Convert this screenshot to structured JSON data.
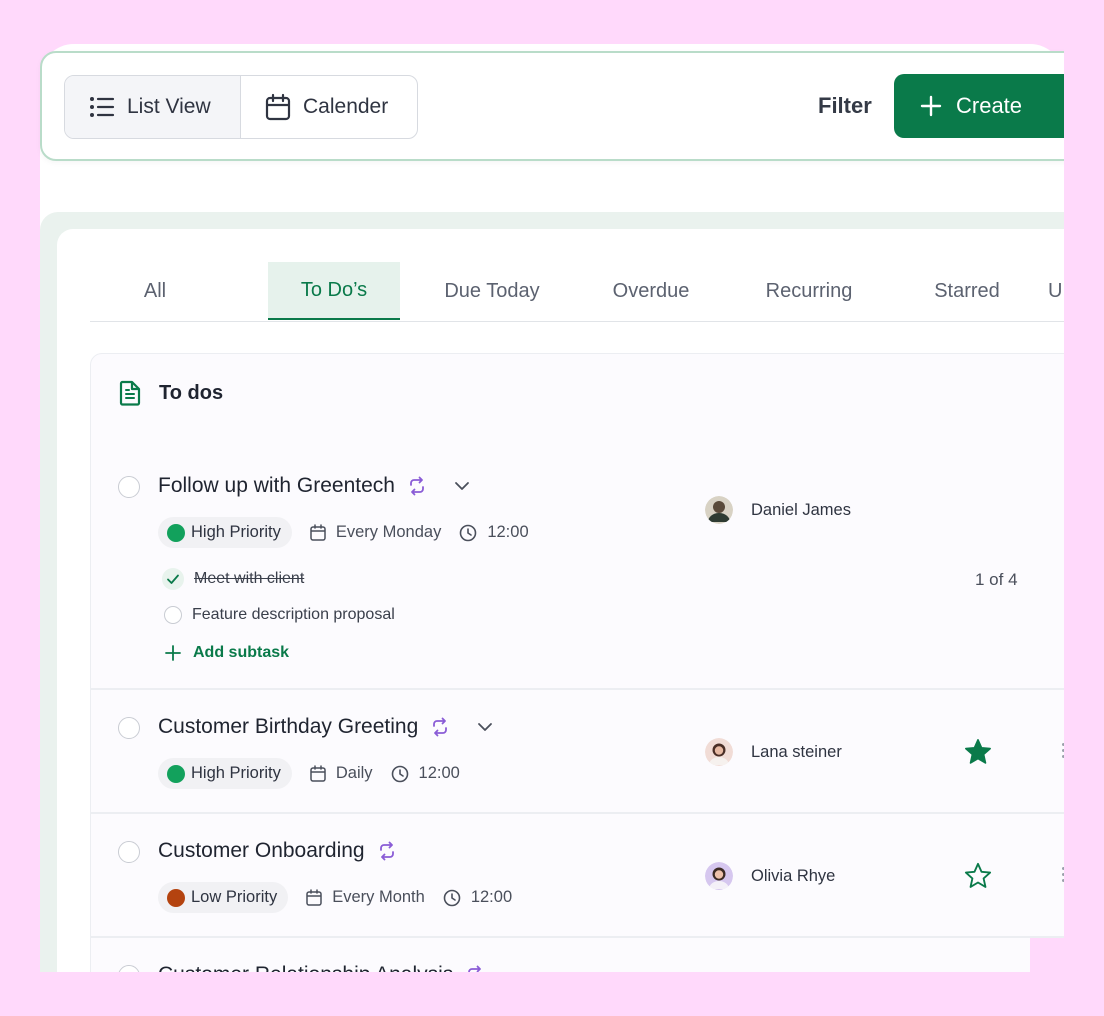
{
  "toolbar": {
    "list_view_label": "List View",
    "calendar_label": "Calender",
    "filter_label": "Filter",
    "create_label": "Create"
  },
  "tabs": [
    {
      "label": "All",
      "active": false
    },
    {
      "label": "To Do’s",
      "active": true
    },
    {
      "label": "Due Today",
      "active": false
    },
    {
      "label": "Overdue",
      "active": false
    },
    {
      "label": "Recurring",
      "active": false
    },
    {
      "label": "Starred",
      "active": false
    },
    {
      "label": "U",
      "active": false
    }
  ],
  "list": {
    "heading": "To dos",
    "tasks": [
      {
        "title": "Follow up with Greentech",
        "recurring": true,
        "expandable": true,
        "priority": "High Priority",
        "priority_color": "#12a15c",
        "schedule": "Every Monday",
        "time": "12:00",
        "assignee": "Daniel James",
        "subtasks": [
          {
            "label": "Meet with client",
            "done": true
          },
          {
            "label": "Feature description proposal",
            "done": false
          }
        ],
        "add_subtask_label": "Add subtask",
        "subtask_counter": "1 of 4"
      },
      {
        "title": "Customer Birthday Greeting",
        "recurring": true,
        "expandable": true,
        "priority": "High Priority",
        "priority_color": "#12a15c",
        "schedule": "Daily",
        "time": "12:00",
        "assignee": "Lana steiner",
        "starred": true
      },
      {
        "title": "Customer Onboarding",
        "recurring": true,
        "expandable": false,
        "priority": "Low Priority",
        "priority_color": "#b4430f",
        "schedule": "Every Month",
        "time": "12:00",
        "assignee": "Olivia Rhye",
        "starred": false
      },
      {
        "title": "Customer Relationship Analysis",
        "recurring": true
      }
    ]
  },
  "colors": {
    "accent": "#0a7a4a",
    "recurring_icon": "#8a5cd6",
    "background": "#ffd9fb"
  }
}
